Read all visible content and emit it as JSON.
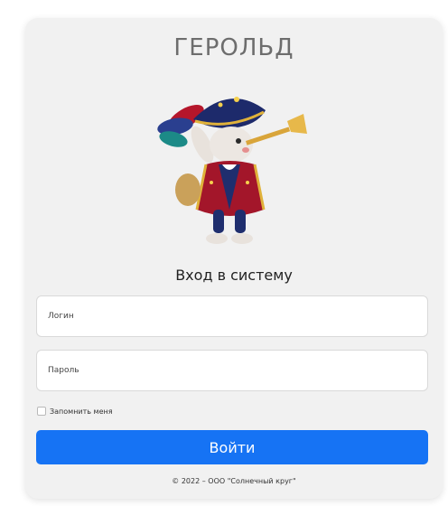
{
  "app": {
    "title": "ГЕРОЛЬД"
  },
  "mascot": {
    "icon": "herald-rabbit-trumpet-icon"
  },
  "login_form": {
    "heading": "Вход в систему",
    "login_label": "Логин",
    "password_label": "Пароль",
    "remember_label": "Запомнить меня",
    "remember_checked": false,
    "submit_label": "Войти"
  },
  "footer": {
    "copyright": "© 2022 – ООО \"Солнечный круг\""
  },
  "colors": {
    "card_background": "#f1f1f1",
    "primary": "#1673f4",
    "title_gray": "#6d6d6d"
  }
}
